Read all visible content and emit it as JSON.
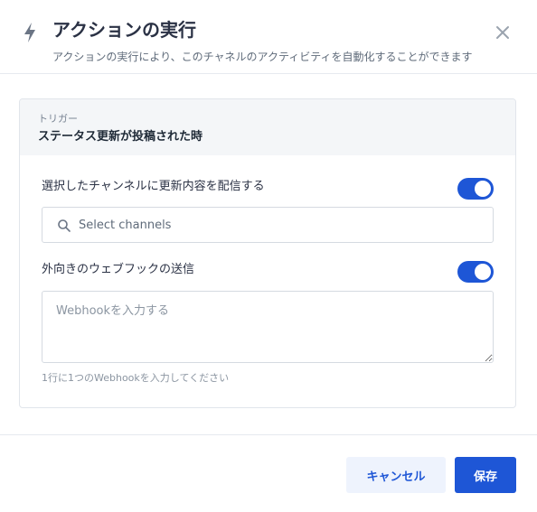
{
  "header": {
    "icon": "bolt-icon",
    "title": "アクションの実行",
    "subtitle": "アクションの実行により、このチャネルのアクティビティを自動化することができます",
    "close_icon": "close-icon"
  },
  "trigger": {
    "label": "トリガー",
    "value": "ステータス更新が投稿された時"
  },
  "broadcast": {
    "label": "選択したチャンネルに更新内容を配信する",
    "enabled": true,
    "search_placeholder": "Select channels",
    "search_value": ""
  },
  "webhook": {
    "label": "外向きのウェブフックの送信",
    "enabled": true,
    "placeholder": "Webhookを入力する",
    "value": "",
    "hint": "1行に1つのWebhookを入力してください"
  },
  "footer": {
    "cancel_label": "キャンセル",
    "save_label": "保存"
  },
  "colors": {
    "accent": "#1e56d6",
    "cancel_bg": "#eef3fd",
    "trigger_bg": "#f4f6f8"
  }
}
